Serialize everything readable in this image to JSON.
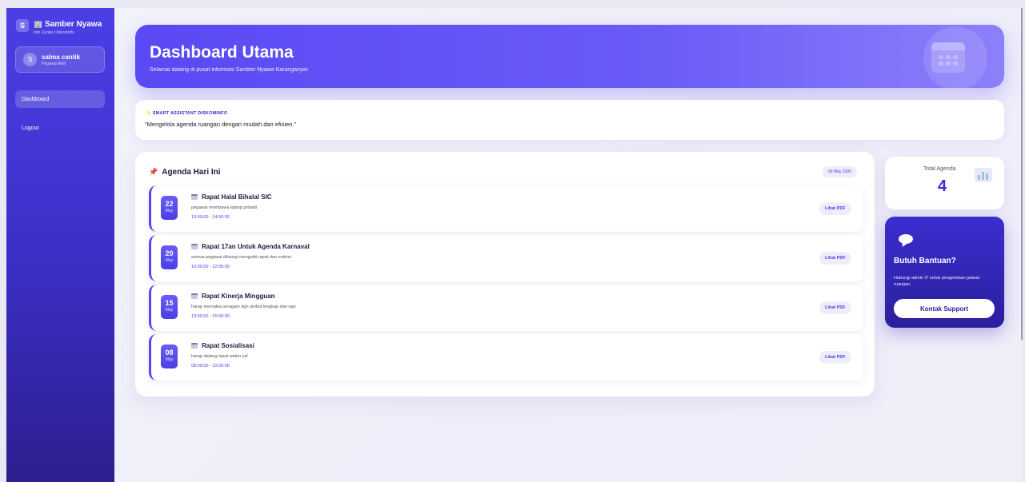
{
  "sidebar": {
    "brand_initial": "S",
    "brand_icon": "building-icon",
    "brand_title": "Samber Nyawa",
    "brand_subtitle": "Info Center Diskominfo",
    "user": {
      "initial": "S",
      "name": "salma cantik",
      "role": "Pegawai Aktif"
    },
    "nav": [
      {
        "label": "Dashboard",
        "active": true
      },
      {
        "label": "Logout",
        "active": false
      }
    ]
  },
  "header": {
    "title": "Dashboard Utama",
    "subtitle": "Selamat datang di pusat informasi Samber Nyawa Karanganyar."
  },
  "assistant": {
    "icon": "sparkle-icon",
    "label": "SMART ASSISTANT DISKOMINFO",
    "quote": "\"Mengelola agenda ruangan dengan mudah dan efisien.\""
  },
  "agenda": {
    "title": "Agenda Hari Ini",
    "date": "09 May 2026",
    "items": [
      {
        "day": "22",
        "month": "May",
        "title": "Rapat Halal Bihalal SIC",
        "desc": "pegawai membawa laptop pribadi",
        "time": "13:00:00 - 14:50:00",
        "button": "Lihat PDF"
      },
      {
        "day": "20",
        "month": "May",
        "title": "Rapat 17an Untuk Agenda Karnaval",
        "desc": "semua pegawai diharap mengukti rapat dan ontime",
        "time": "10:00:00 - 12:00:00",
        "button": "Lihat PDF"
      },
      {
        "day": "15",
        "month": "May",
        "title": "Rapat Kinerja Mingguan",
        "desc": "harap memakai seragam dgn atribut lengkap dan rapi",
        "time": "13:00:00 - 15:00:00",
        "button": "Lihat PDF"
      },
      {
        "day": "08",
        "month": "May",
        "title": "Rapat Sosialisasi",
        "desc": "harap datang tepat waktu ya!",
        "time": "08:00:00 - 10:00:00",
        "button": "Lihat PDF"
      }
    ]
  },
  "stats": {
    "label": "Total Agenda",
    "value": "4"
  },
  "help": {
    "title": "Butuh Bantuan?",
    "text": "Hubungi admin IT untuk pengelolaan jadwal ruangan.",
    "button": "Kontak Support"
  },
  "colors": {
    "accent": "#4a3fe6",
    "sidebar_bottom": "#2c1f8f"
  }
}
